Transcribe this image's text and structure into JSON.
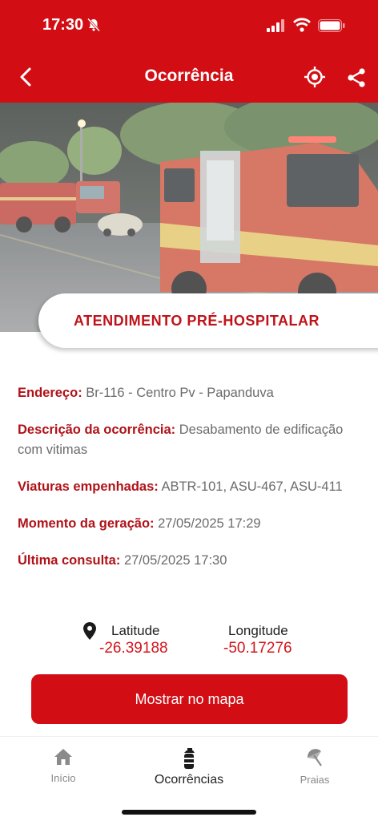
{
  "status_bar": {
    "time": "17:30"
  },
  "app_bar": {
    "title": "Ocorrência"
  },
  "hero": {
    "category": "ATENDIMENTO PRÉ-HOSPITALAR"
  },
  "details": [
    {
      "key": "Endereço:",
      "value": "Br-116 - Centro Pv - Papanduva"
    },
    {
      "key": "Descrição da ocorrência:",
      "value": "Desabamento de edificação com vitimas"
    },
    {
      "key": "Viaturas empenhadas:",
      "value": "ABTR-101, ASU-467, ASU-411"
    },
    {
      "key": "Momento da geração:",
      "value": "27/05/2025 17:29"
    },
    {
      "key": "Última consulta:",
      "value": "27/05/2025 17:30"
    }
  ],
  "coords": {
    "lat_label": "Latitude",
    "lat_value": "-26.39188",
    "lon_label": "Longitude",
    "lon_value": "-50.17276"
  },
  "map_button": "Mostrar no mapa",
  "tabs": [
    {
      "label": "Início",
      "icon": "home-icon"
    },
    {
      "label": "Ocorrências",
      "icon": "fire-extinguisher-icon"
    },
    {
      "label": "Praias",
      "icon": "beach-umbrella-icon"
    }
  ],
  "colors": {
    "brand_red": "#d20d14",
    "label_red": "#b01218",
    "value_red": "#d4141b"
  }
}
